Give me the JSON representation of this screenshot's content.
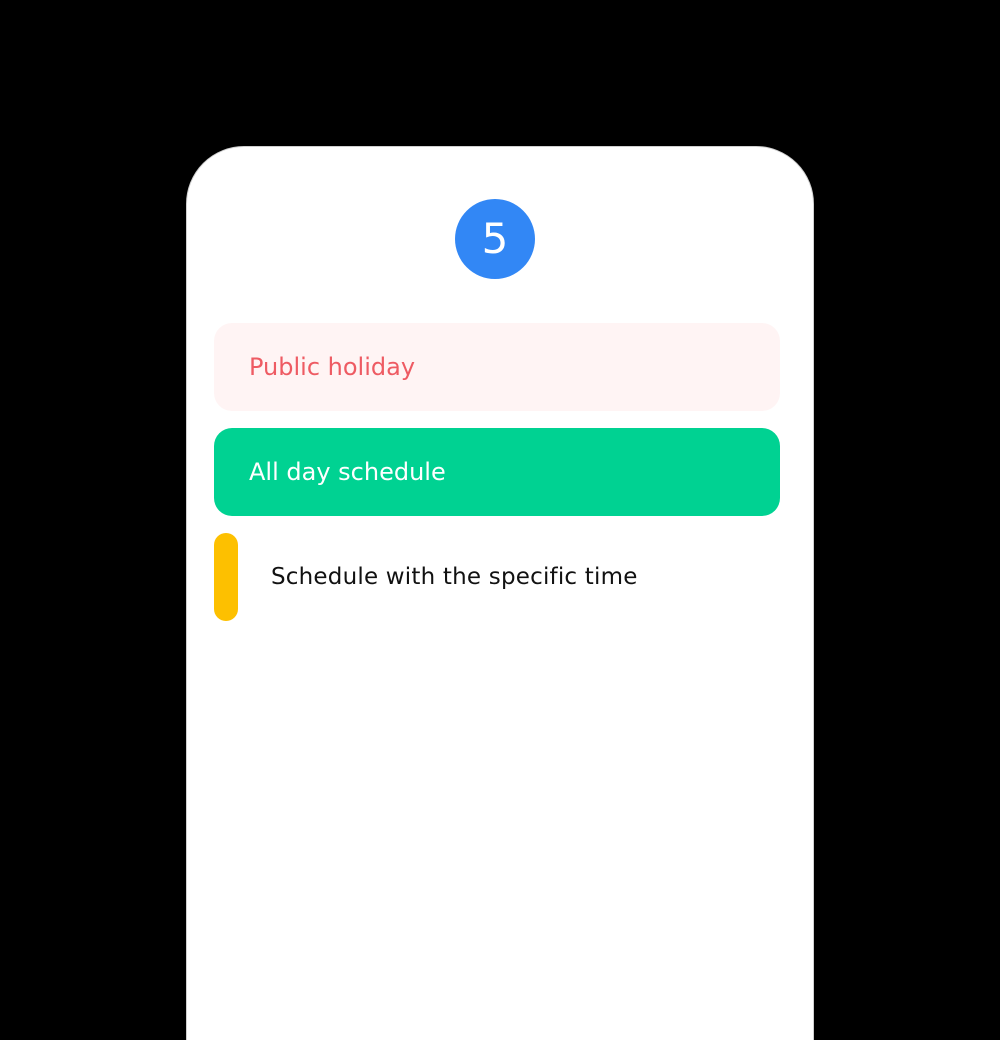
{
  "calendar": {
    "day_number": "5",
    "accent_color": "#3287f5"
  },
  "events": {
    "holiday": {
      "label": "Public holiday",
      "text_color": "#ee5b63",
      "background_color": "#fff4f4"
    },
    "all_day": {
      "label": "All day schedule",
      "background_color": "#00d292"
    },
    "timed": {
      "label": "Schedule with the specific time",
      "indicator_color": "#fdc000"
    }
  }
}
